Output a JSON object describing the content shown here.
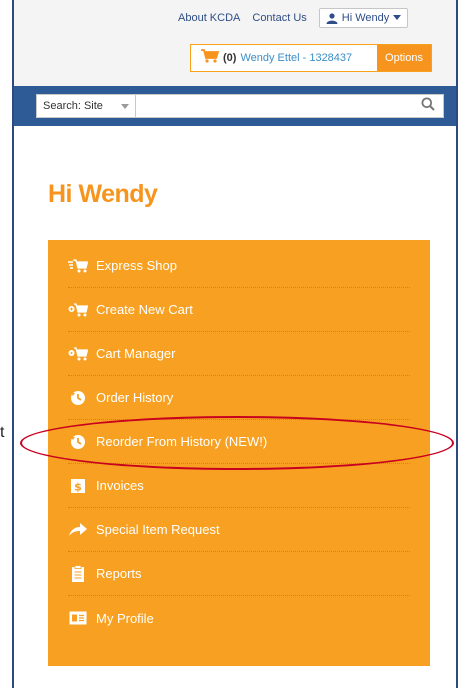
{
  "header": {
    "about_label": "About KCDA",
    "contact_label": "Contact Us",
    "user_label": "Hi Wendy",
    "cart_count": "(0)",
    "cart_user": "Wendy Ettel - 1328437",
    "options_label": "Options"
  },
  "search": {
    "scope_label": "Search: Site",
    "placeholder": ""
  },
  "greeting": "Hi Wendy",
  "menu": {
    "items": [
      {
        "label": "Express Shop",
        "icon": "express-cart-icon"
      },
      {
        "label": "Create New Cart",
        "icon": "new-cart-icon"
      },
      {
        "label": "Cart Manager",
        "icon": "cart-manager-icon"
      },
      {
        "label": "Order History",
        "icon": "history-icon"
      },
      {
        "label": "Reorder From History (NEW!)",
        "icon": "history-icon"
      },
      {
        "label": "Invoices",
        "icon": "invoice-icon"
      },
      {
        "label": "Special Item Request",
        "icon": "share-arrow-icon"
      },
      {
        "label": "Reports",
        "icon": "clipboard-icon"
      },
      {
        "label": "My Profile",
        "icon": "id-card-icon"
      }
    ]
  },
  "side_glyph": "t",
  "colors": {
    "brand_blue": "#2e5a96",
    "accent_orange": "#f7941d",
    "panel_orange": "#f7a021",
    "link_blue": "#2f4d86",
    "highlight_red": "#c8001f"
  }
}
